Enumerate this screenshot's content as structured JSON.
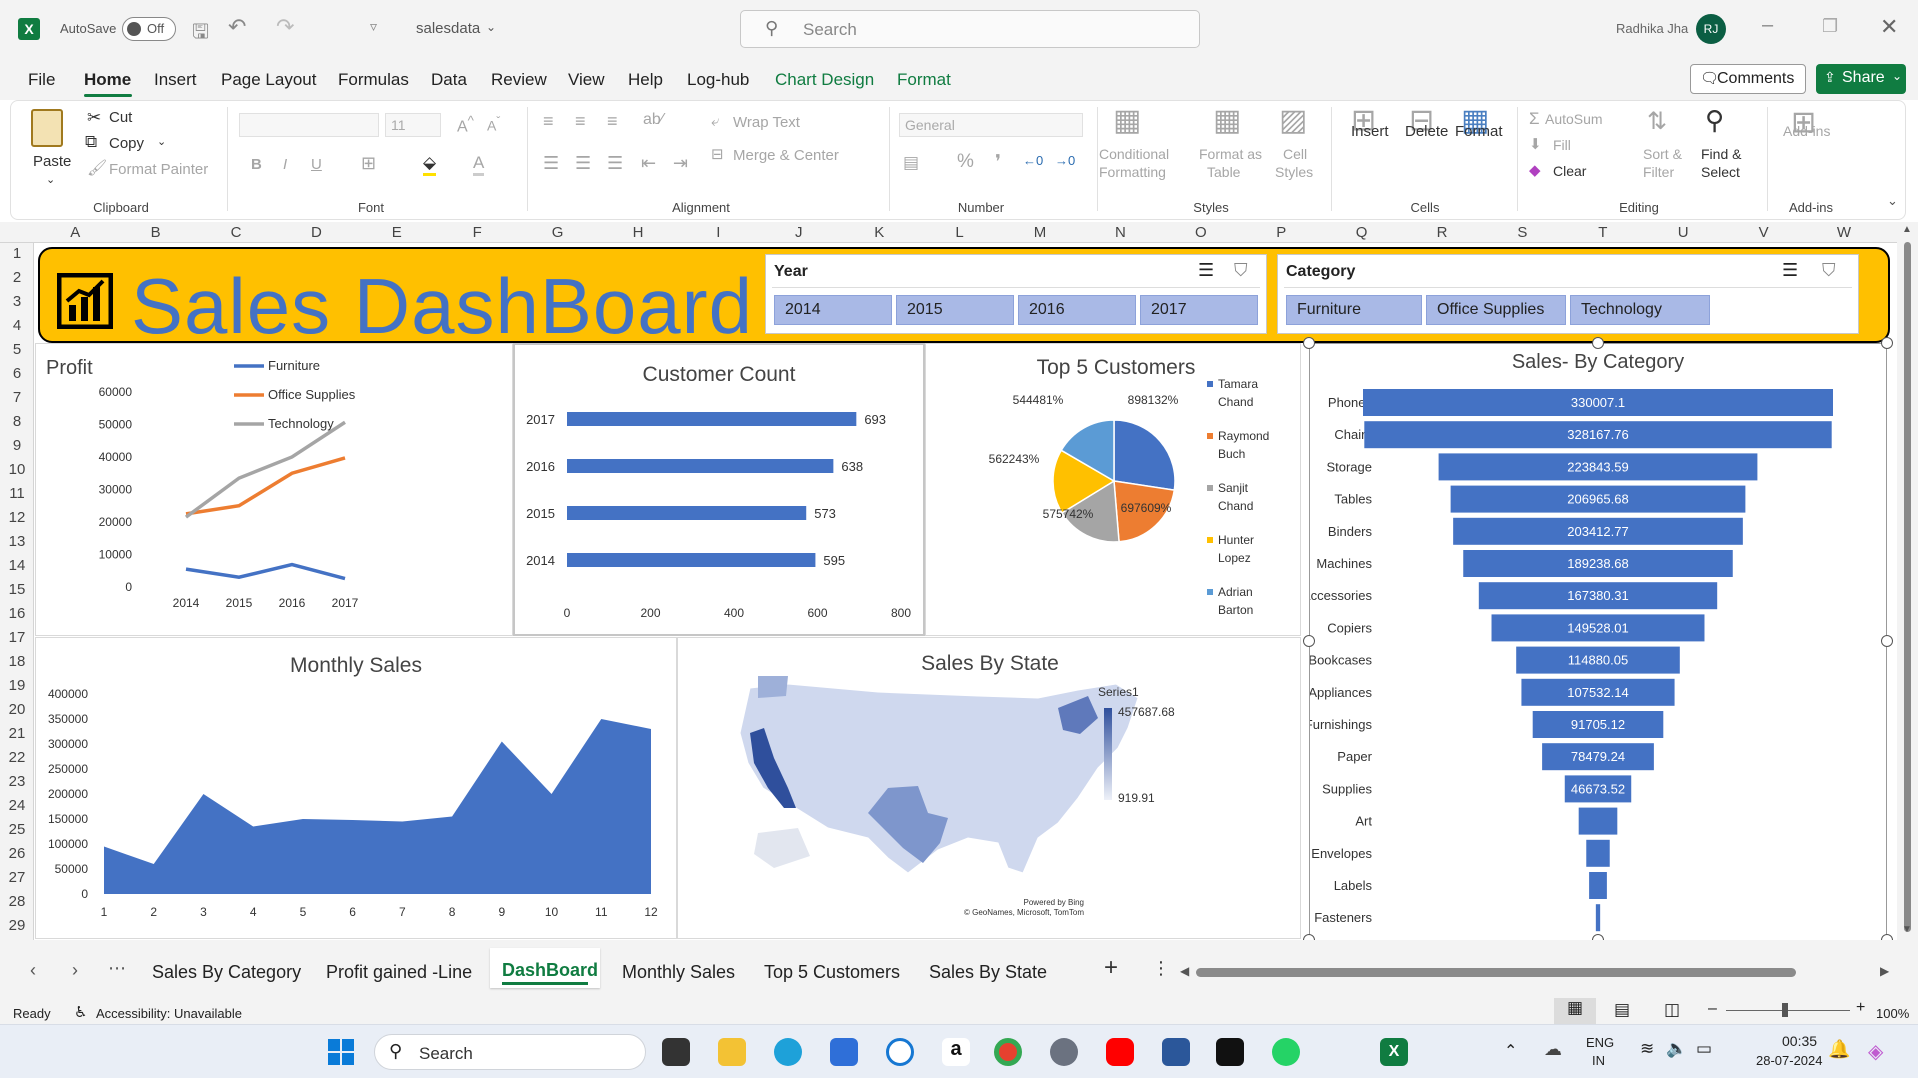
{
  "titlebar": {
    "autosave_label": "AutoSave",
    "autosave_state": "Off",
    "filename": "salesdata",
    "search_placeholder": "Search",
    "user_name": "Radhika Jha",
    "user_initials": "RJ"
  },
  "menu": {
    "items": [
      "File",
      "Home",
      "Insert",
      "Page Layout",
      "Formulas",
      "Data",
      "Review",
      "View",
      "Help",
      "Log-hub",
      "Chart Design",
      "Format"
    ],
    "active": "Home",
    "comments": "Comments",
    "share": "Share"
  },
  "ribbon": {
    "clipboard": {
      "paste": "Paste",
      "cut": "Cut",
      "copy": "Copy",
      "format_painter": "Format Painter",
      "group": "Clipboard"
    },
    "font": {
      "size": "11",
      "group": "Font"
    },
    "alignment": {
      "wrap": "Wrap Text",
      "merge": "Merge & Center",
      "group": "Alignment"
    },
    "number": {
      "format": "General",
      "group": "Number"
    },
    "styles": {
      "cond1": "Conditional",
      "cond2": "Formatting",
      "fmt1": "Format as",
      "fmt2": "Table",
      "cell1": "Cell",
      "cell2": "Styles",
      "group": "Styles"
    },
    "cells": {
      "insert": "Insert",
      "delete": "Delete",
      "format": "Format",
      "group": "Cells"
    },
    "editing": {
      "autosum": "AutoSum",
      "fill": "Fill",
      "clear": "Clear",
      "sort1": "Sort &",
      "sort2": "Filter",
      "find1": "Find &",
      "find2": "Select",
      "group": "Editing"
    },
    "addins": {
      "label": "Add-ins",
      "group": "Add-ins"
    }
  },
  "columns": [
    "A",
    "B",
    "C",
    "D",
    "E",
    "F",
    "G",
    "H",
    "I",
    "J",
    "K",
    "L",
    "M",
    "N",
    "O",
    "P",
    "Q",
    "R",
    "S",
    "T",
    "U",
    "V",
    "W"
  ],
  "rows": [
    "1",
    "2",
    "3",
    "4",
    "5",
    "6",
    "7",
    "8",
    "9",
    "10",
    "11",
    "12",
    "13",
    "14",
    "15",
    "16",
    "17",
    "18",
    "19",
    "20",
    "21",
    "22",
    "23",
    "24",
    "25",
    "26",
    "27",
    "28",
    "29"
  ],
  "dashboard": {
    "title": "Sales DashBoard",
    "year_slicer": {
      "title": "Year",
      "items": [
        "2014",
        "2015",
        "2016",
        "2017"
      ]
    },
    "category_slicer": {
      "title": "Category",
      "items": [
        "Furniture",
        "Office Supplies",
        "Technology"
      ]
    }
  },
  "colors": {
    "banner": "#ffc000",
    "blue": "#4472c4",
    "orange": "#ed7d31",
    "gray": "#a5a5a5",
    "yellow": "#ffc000",
    "lightblue": "#5b9bd5",
    "excel_green": "#107c41"
  },
  "chart_data": [
    {
      "type": "line",
      "title": "Profit",
      "categories": [
        "2014",
        "2015",
        "2016",
        "2017"
      ],
      "ylim": [
        0,
        60000
      ],
      "yticks": [
        "0",
        "10000",
        "20000",
        "30000",
        "40000",
        "50000",
        "60000"
      ],
      "series": [
        {
          "name": "Furniture",
          "values": [
            5500,
            3000,
            6900,
            2600
          ]
        },
        {
          "name": "Office Supplies",
          "values": [
            22500,
            25000,
            35000,
            39700
          ]
        },
        {
          "name": "Technology",
          "values": [
            21500,
            33500,
            40000,
            50700
          ]
        }
      ],
      "legend": "top"
    },
    {
      "type": "bar",
      "title": "Customer Count",
      "categories": [
        "2017",
        "2016",
        "2015",
        "2014"
      ],
      "values": [
        693,
        638,
        573,
        595
      ],
      "xlim": [
        0,
        800
      ],
      "xticks": [
        "0",
        "200",
        "400",
        "600",
        "800"
      ]
    },
    {
      "type": "pie",
      "title": "Top 5 Customers",
      "labels": [
        "Tamara Chand",
        "Raymond Buch",
        "Sanjit Chand",
        "Hunter Lopez",
        "Adrian Barton"
      ],
      "values": [
        898132,
        697609,
        575742,
        562243,
        544481
      ],
      "data_labels": [
        "898132%",
        "697609%",
        "575742%",
        "562243%",
        "544481%"
      ],
      "legend": "right"
    },
    {
      "type": "bar",
      "title": "Sales- By Category",
      "categories": [
        "Phones",
        "Chairs",
        "Storage",
        "Tables",
        "Binders",
        "Machines",
        "Accessories",
        "Copiers",
        "Bookcases",
        "Appliances",
        "Furnishings",
        "Paper",
        "Supplies",
        "Art",
        "Envelopes",
        "Labels",
        "Fasteners"
      ],
      "values": [
        330007.1,
        328167.76,
        223843.59,
        206965.68,
        203412.77,
        189238.68,
        167380.31,
        149528.01,
        114880.05,
        107532.14,
        91705.12,
        78479.24,
        46673.52,
        27118.79,
        16476.4,
        12486.31,
        3024.28
      ],
      "data_labels": [
        "330007.1",
        "328167.76",
        "223843.59",
        "206965.68",
        "203412.77",
        "189238.68",
        "167380.31",
        "149528.01",
        "114880.05",
        "107532.14",
        "91705.12",
        "78479.24",
        "46673.52",
        "",
        "",
        "",
        ""
      ]
    },
    {
      "type": "area",
      "title": "Monthly Sales",
      "categories": [
        "1",
        "2",
        "3",
        "4",
        "5",
        "6",
        "7",
        "8",
        "9",
        "10",
        "11",
        "12"
      ],
      "values": [
        95000,
        60000,
        200000,
        135000,
        150000,
        148000,
        145000,
        155000,
        305000,
        200000,
        350000,
        330000
      ],
      "ylim": [
        0,
        400000
      ],
      "yticks": [
        "0",
        "50000",
        "100000",
        "150000",
        "200000",
        "250000",
        "300000",
        "350000",
        "400000"
      ]
    },
    {
      "type": "map",
      "title": "Sales By State",
      "series_name": "Series1",
      "max_label": "457687.68",
      "min_label": "919.91",
      "credit1": "Powered by Bing",
      "credit2": "© GeoNames, Microsoft, TomTom"
    }
  ],
  "sheet_tabs": {
    "items": [
      "Sales By Category",
      "Profit gained -Line",
      "DashBoard",
      "Monthly Sales",
      "Top 5 Customers",
      "Sales By State"
    ],
    "active": "DashBoard"
  },
  "status": {
    "ready": "Ready",
    "accessibility": "Accessibility: Unavailable",
    "zoom": "100%"
  },
  "taskbar": {
    "search": "Search",
    "lang1": "ENG",
    "lang2": "IN",
    "time": "00:35",
    "date": "28-07-2024"
  }
}
